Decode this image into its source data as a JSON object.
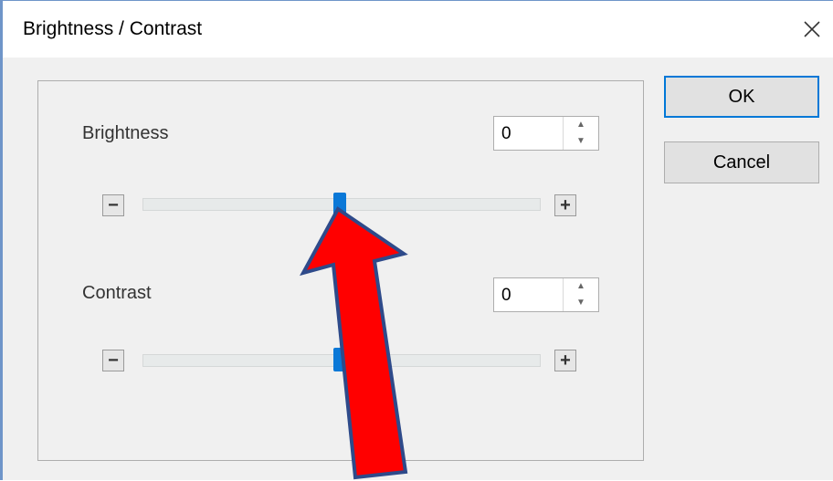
{
  "window": {
    "title": "Brightness / Contrast",
    "close_icon": "close-icon"
  },
  "brightness": {
    "label": "Brightness",
    "value": "0",
    "slider_minus": "−",
    "slider_plus": "+",
    "slider_level": 0.5
  },
  "contrast": {
    "label": "Contrast",
    "value": "0",
    "slider_minus": "−",
    "slider_plus": "+",
    "slider_level": 0.5
  },
  "buttons": {
    "ok": "OK",
    "cancel": "Cancel"
  },
  "annotation": {
    "type": "red-arrow",
    "color": "#ff0000",
    "outline": "#2e4a8a"
  },
  "colors": {
    "accent": "#0078d7",
    "slider_thumb": "#0a78d7",
    "window_border": "#6f95c9"
  }
}
